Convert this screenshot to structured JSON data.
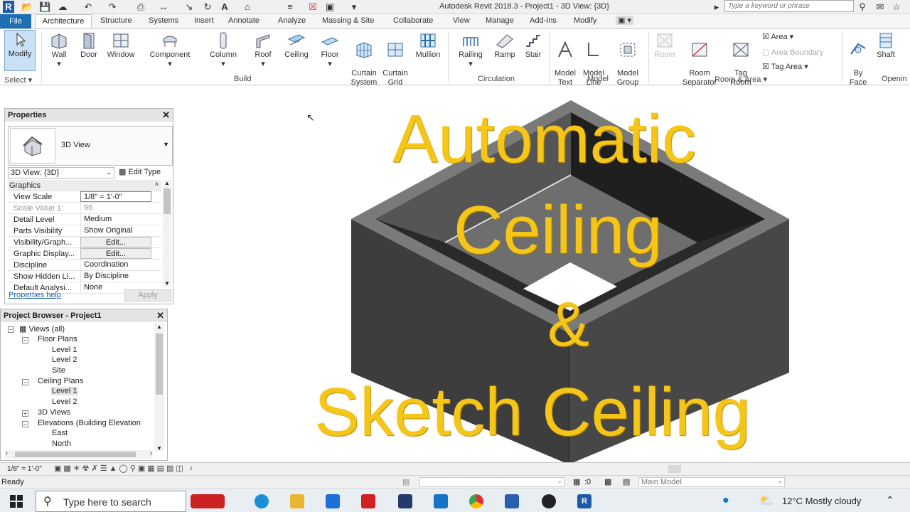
{
  "titlebar": {
    "app_logo": "R",
    "window_title": "Autodesk Revit 2018.3 -      Project1 - 3D View: {3D}",
    "search_placeholder": "Type a keyword or phrase"
  },
  "ribbon_tabs": [
    "File",
    "Architecture",
    "Structure",
    "Systems",
    "Insert",
    "Annotate",
    "Analyze",
    "Massing & Site",
    "Collaborate",
    "View",
    "Manage",
    "Add-Ins",
    "Modify"
  ],
  "ribbon": {
    "select": {
      "modify": "Modify",
      "panel": "Select"
    },
    "build": {
      "wall": "Wall",
      "door": "Door",
      "window": "Window",
      "component": "Component",
      "column": "Column",
      "roof": "Roof",
      "ceiling": "Ceiling",
      "floor": "Floor",
      "curtain_system": "Curtain\nSystem",
      "curtain_grid": "Curtain\nGrid",
      "mullion": "Mullion",
      "panel": "Build"
    },
    "circulation": {
      "railing": "Railing",
      "ramp": "Ramp",
      "stair": "Stair",
      "panel": "Circulation"
    },
    "model": {
      "model_text": "Model\nText",
      "model_line": "Model\nLine",
      "model_group": "Model\nGroup",
      "panel": "Model"
    },
    "room_area": {
      "room": "Room",
      "room_separator": "Room\nSeparator",
      "tag_room": "Tag\nRoom",
      "area": "Area",
      "area_boundary": "Area  Boundary",
      "tag_area": "Tag  Area",
      "panel": "Room & Area"
    },
    "opening": {
      "by_face": "By\nFace",
      "shaft": "Shaft",
      "panel": "Openin"
    }
  },
  "properties": {
    "title": "Properties",
    "type_name": "3D View",
    "view_selector": "3D View: {3D}",
    "edit_type": "Edit Type",
    "rows": [
      {
        "key": "Graphics",
        "value": "",
        "kind": "group"
      },
      {
        "key": "View Scale",
        "value": "1/8\" = 1'-0\"",
        "kind": "input"
      },
      {
        "key": "Scale Value    1:",
        "value": "96",
        "kind": "dim"
      },
      {
        "key": "Detail Level",
        "value": "Medium",
        "kind": "text"
      },
      {
        "key": "Parts Visibility",
        "value": "Show Original",
        "kind": "text"
      },
      {
        "key": "Visibility/Graph...",
        "value": "Edit...",
        "kind": "button"
      },
      {
        "key": "Graphic Display...",
        "value": "Edit...",
        "kind": "button"
      },
      {
        "key": "Discipline",
        "value": "Coordination",
        "kind": "text"
      },
      {
        "key": "Show Hidden Li...",
        "value": "By Discipline",
        "kind": "text"
      },
      {
        "key": "Default Analysi...",
        "value": "None",
        "kind": "text"
      }
    ],
    "help_link": "Properties help",
    "apply": "Apply"
  },
  "project_browser": {
    "title": "Project Browser - Project1",
    "tree": {
      "views_all": "Views (all)",
      "floor_plans": "Floor Plans",
      "fp_level1": "Level 1",
      "fp_level2": "Level 2",
      "fp_site": "Site",
      "ceiling_plans": "Ceiling Plans",
      "cp_level1": "Level 1",
      "cp_level2": "Level 2",
      "views_3d": "3D Views",
      "elevations": "Elevations (Building Elevation",
      "el_east": "East",
      "el_north": "North"
    }
  },
  "overlay": {
    "line1": "Automatic",
    "line2": "Ceiling",
    "line3": "&",
    "line4": "Sketch Ceiling",
    "color": "#f5c518"
  },
  "view_control": {
    "scale": "1/8\" = 1'-0\""
  },
  "status": {
    "ready": "Ready",
    "filter_count": ":0",
    "workset": "Main Model"
  },
  "taskbar": {
    "search_text": "Type here to search",
    "weather": "12°C  Mostly cloudy"
  }
}
